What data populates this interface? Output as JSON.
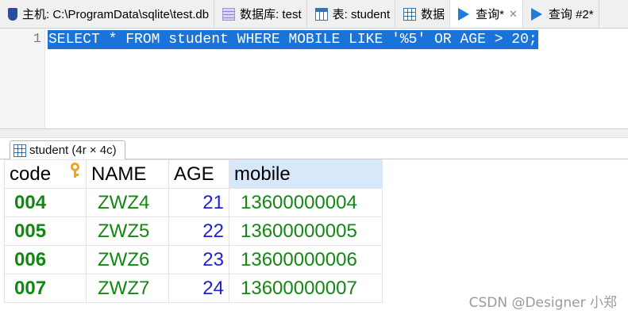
{
  "tabs": [
    {
      "label": "主机: C:\\ProgramData\\sqlite\\test.db",
      "icon": "database-icon"
    },
    {
      "label": "数据库: test",
      "icon": "schema-icon"
    },
    {
      "label": "表: student",
      "icon": "table-icon"
    },
    {
      "label": "数据",
      "icon": "grid-icon"
    },
    {
      "label": "查询*",
      "icon": "play-icon",
      "active": true
    },
    {
      "label": "查询 #2*",
      "icon": "play-icon"
    }
  ],
  "editor": {
    "line_number": "1",
    "sql": "SELECT * FROM student WHERE MOBILE LIKE '%5' OR AGE > 20;"
  },
  "result": {
    "tab_label": "student (4r × 4c)",
    "columns": [
      "code",
      "NAME",
      "AGE",
      "mobile"
    ],
    "rows": [
      {
        "code": "004",
        "name": "ZWZ4",
        "age": "21",
        "mobile": "13600000004"
      },
      {
        "code": "005",
        "name": "ZWZ5",
        "age": "22",
        "mobile": "13600000005"
      },
      {
        "code": "006",
        "name": "ZWZ6",
        "age": "23",
        "mobile": "13600000006"
      },
      {
        "code": "007",
        "name": "ZWZ7",
        "age": "24",
        "mobile": "13600000007"
      }
    ]
  },
  "watermark": "CSDN @Designer 小郑",
  "colors": {
    "selection": "#1a73d8",
    "text_value": "#118811",
    "number_value": "#1f1fd6",
    "selected_header": "#d6e8f9"
  }
}
